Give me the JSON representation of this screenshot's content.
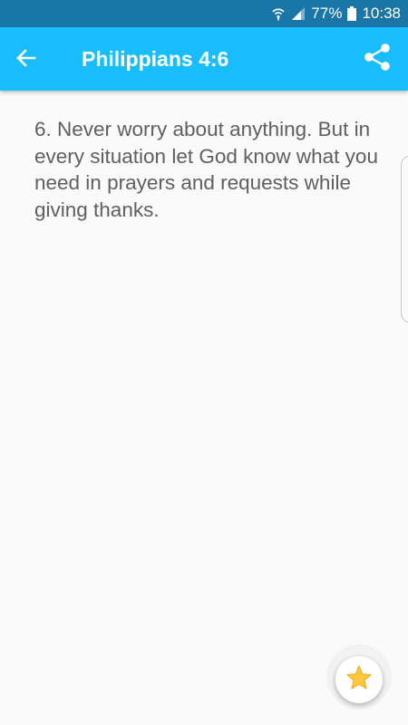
{
  "status_bar": {
    "battery": "77%",
    "time": "10:38"
  },
  "app_bar": {
    "title": "Philippians 4:6",
    "color": "#19bdfb"
  },
  "verse": {
    "text": "6. Never worry about anything. But in every situation let God know what you need in prayers and requests while giving thanks."
  },
  "icons": {
    "back": "arrow-left-icon",
    "share": "share-icon",
    "favorite": "star-icon"
  }
}
